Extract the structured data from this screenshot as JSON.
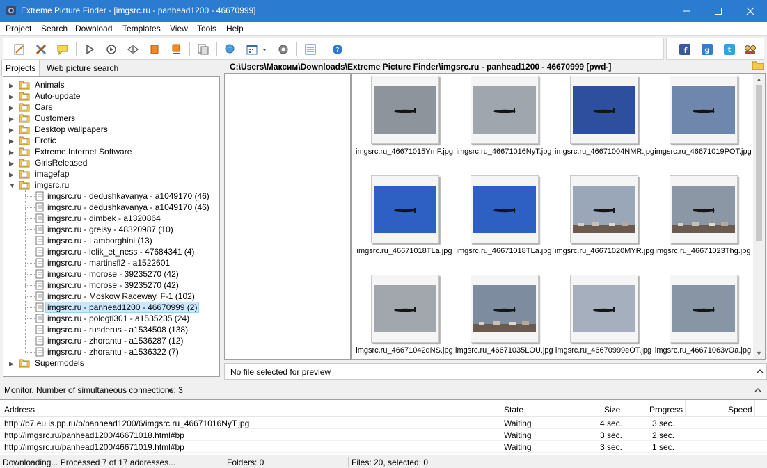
{
  "window": {
    "title": "Extreme Picture Finder - [imgsrc.ru - panhead1200 - 46670999]"
  },
  "menu": [
    "Project",
    "Search",
    "Download",
    "Templates",
    "View",
    "Tools",
    "Help"
  ],
  "left_tabs": [
    "Projects",
    "Web picture search"
  ],
  "tree": {
    "folders_top": [
      "Animals",
      "Auto-update",
      "Cars",
      "Customers",
      "Desktop wallpapers",
      "Erotic",
      "Extreme Internet Software",
      "GirlsReleased",
      "imagefap"
    ],
    "expanded_folder": "imgsrc.ru",
    "children": [
      "imgsrc.ru - dedushkavanya - a1049170 (46)",
      "imgsrc.ru - dedushkavanya - a1049170 (46)",
      "imgsrc.ru - dimbek - a1320864",
      "imgsrc.ru - greisy - 48320987 (10)",
      "imgsrc.ru - Lamborghini (13)",
      "imgsrc.ru - lelik_et_ness - 47684341 (4)",
      "imgsrc.ru - martinsfl2 - a1522601",
      "imgsrc.ru - morose - 39235270 (42)",
      "imgsrc.ru - morose - 39235270 (42)",
      "imgsrc.ru - Moskow Raceway. F-1 (102)",
      "imgsrc.ru - panhead1200 - 46670999 (2)",
      "imgsrc.ru - pologti301 - a1535235 (24)",
      "imgsrc.ru - rusderus - a1534508 (138)",
      "imgsrc.ru - zhorantu - a1536287 (12)",
      "imgsrc.ru - zhorantu - a1536322 (7)"
    ],
    "selected_index": 10,
    "folders_bottom": [
      "Supermodels"
    ]
  },
  "path": "C:\\Users\\Максим\\Downloads\\Extreme Picture Finder\\imgsrc.ru - panhead1200 - 46670999 [pwd-]",
  "thumbnails": [
    {
      "name": "imgsrc.ru_46671015YmF.jpg",
      "sky": "#8e949c"
    },
    {
      "name": "imgsrc.ru_46671016NyT.jpg",
      "sky": "#a0a6ae"
    },
    {
      "name": "imgsrc.ru_46671004NMR.jpg",
      "sky": "#2d4f9e"
    },
    {
      "name": "imgsrc.ru_46671019POT.jpg",
      "sky": "#6f86ad"
    },
    {
      "name": "imgsrc.ru_46671018TLa.jpg",
      "sky": "#2e5fc2"
    },
    {
      "name": "imgsrc.ru_46671018TLa.jpg",
      "sky": "#2e5fc2"
    },
    {
      "name": "imgsrc.ru_46671020MYR.jpg",
      "sky": "#9aa7b8"
    },
    {
      "name": "imgsrc.ru_46671023Thg.jpg",
      "sky": "#8c97a6"
    },
    {
      "name": "imgsrc.ru_46671042qNS.jpg",
      "sky": "#a2a7ad"
    },
    {
      "name": "imgsrc.ru_46671035LOU.jpg",
      "sky": "#7d8c9f"
    },
    {
      "name": "imgsrc.ru_46670999eOT.jpg",
      "sky": "#a5afbd"
    },
    {
      "name": "imgsrc.ru_46671063vOa.jpg",
      "sky": "#8895a5"
    }
  ],
  "preview": {
    "text": "No file selected for preview"
  },
  "monitor": {
    "text": "Monitor. Number of simultaneous connections: 3"
  },
  "downloads": {
    "columns": [
      "Address",
      "State",
      "Size",
      "Progress",
      "Speed"
    ],
    "rows": [
      [
        "http://b7.eu.is.pp.ru/p/panhead1200/6/imgsrc.ru_46671016NyT.jpg",
        "Waiting",
        "4 sec.",
        "3 sec.",
        ""
      ],
      [
        "http://imgsrc.ru/panhead1200/46671018.html#bp",
        "Waiting",
        "3 sec.",
        "2 sec.",
        ""
      ],
      [
        "http://imgsrc.ru/panhead1200/46671019.html#bp",
        "Waiting",
        "3 sec.",
        "1 sec.",
        ""
      ]
    ]
  },
  "status": {
    "left": "Downloading... Processed 7 of 17 addresses...",
    "folders": "Folders: 0",
    "files": "Files: 20, selected: 0"
  }
}
